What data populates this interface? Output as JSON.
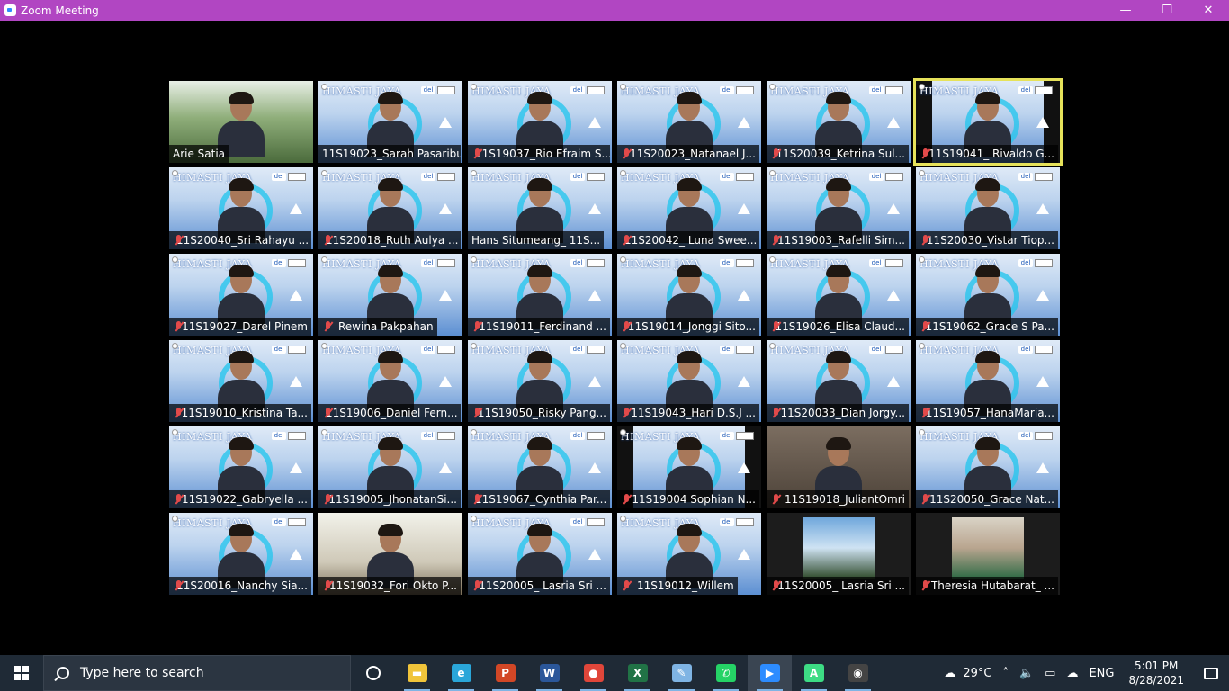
{
  "window": {
    "title": "Zoom Meeting",
    "controls": {
      "minimize": "—",
      "maximize": "❐",
      "close": "✕"
    }
  },
  "participants": [
    {
      "name": "Arie Satia",
      "muted": false,
      "bg": "campus",
      "active": false
    },
    {
      "name": "11S19023_Sarah Pasaribu",
      "muted": false,
      "bg": "himasti",
      "active": false
    },
    {
      "name": "11S19037_Rio Efraim S...",
      "muted": true,
      "bg": "himasti",
      "active": false
    },
    {
      "name": "11S20023_Natanael J...",
      "muted": true,
      "bg": "himasti",
      "active": false
    },
    {
      "name": "11S20039_Ketrina Sul...",
      "muted": true,
      "bg": "himasti",
      "active": false
    },
    {
      "name": "11S19041_ Rivaldo G...",
      "muted": true,
      "bg": "himasti-dark",
      "active": true
    },
    {
      "name": "11S20040_Sri Rahayu ...",
      "muted": true,
      "bg": "himasti",
      "active": false
    },
    {
      "name": "11S20018_Ruth Aulya ...",
      "muted": true,
      "bg": "himasti",
      "active": false
    },
    {
      "name": "Hans Situmeang_ 11S...",
      "muted": false,
      "bg": "himasti",
      "active": false
    },
    {
      "name": "11S20042_ Luna Swee...",
      "muted": true,
      "bg": "himasti",
      "active": false
    },
    {
      "name": "11S19003_Rafelli Sim...",
      "muted": true,
      "bg": "himasti",
      "active": false
    },
    {
      "name": "11S20030_Vistar Tiop...",
      "muted": true,
      "bg": "himasti",
      "active": false
    },
    {
      "name": "11S19027_Darel Pinem",
      "muted": true,
      "bg": "himasti",
      "active": false
    },
    {
      "name": "Rewina Pakpahan",
      "muted": true,
      "bg": "himasti",
      "active": false
    },
    {
      "name": "11S19011_Ferdinand ...",
      "muted": true,
      "bg": "himasti",
      "active": false
    },
    {
      "name": "11S19014_Jonggi Sito...",
      "muted": true,
      "bg": "himasti",
      "active": false
    },
    {
      "name": "11S19026_Elisa Claud...",
      "muted": true,
      "bg": "himasti",
      "active": false
    },
    {
      "name": "11S19062_Grace S Pa...",
      "muted": true,
      "bg": "himasti",
      "active": false
    },
    {
      "name": "11S19010_Kristina Ta...",
      "muted": true,
      "bg": "himasti",
      "active": false
    },
    {
      "name": "11S19006_Daniel Fern...",
      "muted": true,
      "bg": "himasti",
      "active": false
    },
    {
      "name": "11S19050_Risky Pang...",
      "muted": true,
      "bg": "himasti",
      "active": false
    },
    {
      "name": "11S19043_Hari D.S.J ...",
      "muted": true,
      "bg": "himasti",
      "active": false
    },
    {
      "name": "11S20033_Dian Jorgy...",
      "muted": true,
      "bg": "himasti",
      "active": false
    },
    {
      "name": "11S19057_HanaMaria...",
      "muted": true,
      "bg": "himasti",
      "active": false
    },
    {
      "name": "11S19022_Gabryella ...",
      "muted": true,
      "bg": "himasti",
      "active": false
    },
    {
      "name": "11S19005_JhonatanSi...",
      "muted": true,
      "bg": "himasti",
      "active": false
    },
    {
      "name": "11S19067_Cynthia Par...",
      "muted": true,
      "bg": "himasti",
      "active": false
    },
    {
      "name": "11S19004 Sophian N...",
      "muted": true,
      "bg": "himasti-dark",
      "active": false
    },
    {
      "name": "11S19018_JuliantOmri",
      "muted": true,
      "bg": "dim",
      "active": false
    },
    {
      "name": "11S20050_Grace Nat...",
      "muted": true,
      "bg": "himasti",
      "active": false
    },
    {
      "name": "11S20016_Nanchy Sia...",
      "muted": true,
      "bg": "himasti",
      "active": false
    },
    {
      "name": "11S19032_Fori Okto P...",
      "muted": true,
      "bg": "room",
      "active": false
    },
    {
      "name": "11S20005_ Lasria Sri ...",
      "muted": true,
      "bg": "himasti",
      "active": false
    },
    {
      "name": "11S19012_Willem",
      "muted": true,
      "bg": "himasti",
      "active": false
    },
    {
      "name": "11S20005_ Lasria Sri ...",
      "muted": true,
      "bg": "sky-thumb",
      "active": false
    },
    {
      "name": "Theresia Hutabarat_ ...",
      "muted": true,
      "bg": "portrait-thumb",
      "active": false
    }
  ],
  "tile_overlay": {
    "banner": "HIMASTI JAYA",
    "logo": "del"
  },
  "taskbar": {
    "search_placeholder": "Type here to search",
    "apps": [
      {
        "name": "task-view-icon",
        "glyph": "◯"
      },
      {
        "name": "file-explorer-icon",
        "glyph": "▬",
        "color": "#f0c43a"
      },
      {
        "name": "edge-icon",
        "glyph": "e",
        "color": "#2aa6d9"
      },
      {
        "name": "powerpoint-icon",
        "glyph": "P",
        "color": "#d24726"
      },
      {
        "name": "word-icon",
        "glyph": "W",
        "color": "#2b579a"
      },
      {
        "name": "chrome-icon",
        "glyph": "●",
        "color": "#e0463a"
      },
      {
        "name": "excel-icon",
        "glyph": "X",
        "color": "#217346"
      },
      {
        "name": "paint-icon",
        "glyph": "✎",
        "color": "#7fb4e4"
      },
      {
        "name": "whatsapp-icon",
        "glyph": "✆",
        "color": "#25d366"
      },
      {
        "name": "zoom-icon",
        "glyph": "▶",
        "color": "#2d8cff"
      },
      {
        "name": "android-studio-icon",
        "glyph": "A",
        "color": "#3ddc84"
      },
      {
        "name": "obs-icon",
        "glyph": "◉",
        "color": "#444"
      }
    ],
    "weather": "29°C",
    "language": "ENG",
    "time": "5:01 PM",
    "date": "8/28/2021"
  }
}
